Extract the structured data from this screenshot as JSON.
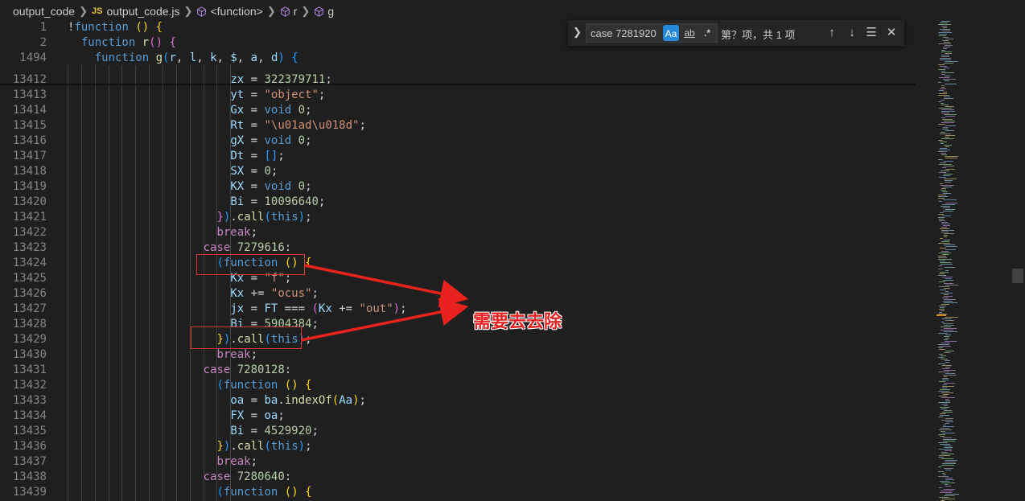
{
  "breadcrumb": {
    "folder": "output_code",
    "file_badge": "JS",
    "file": "output_code.js",
    "func": "<function>",
    "r": "r",
    "g": "g"
  },
  "find_widget": {
    "query": "case 7281920",
    "match_case": "Aa",
    "whole_word": "ab",
    "regex": ".*",
    "result": "第？项，共 1 项"
  },
  "annotation": {
    "label": "需要去去除",
    "color": "#e62222"
  },
  "sticky_lines": [
    {
      "num": "1",
      "indent": 0,
      "tokens": [
        [
          "pl",
          "!"
        ],
        [
          "kw",
          "function"
        ],
        [
          "pl",
          " "
        ],
        [
          "p1",
          "()"
        ],
        [
          "pl",
          " "
        ],
        [
          "p1",
          "{"
        ]
      ]
    },
    {
      "num": "2",
      "indent": 1,
      "tokens": [
        [
          "kw",
          "function"
        ],
        [
          "pl",
          " "
        ],
        [
          "fn",
          "r"
        ],
        [
          "p2",
          "()"
        ],
        [
          "pl",
          " "
        ],
        [
          "p2",
          "{"
        ]
      ]
    },
    {
      "num": "1494",
      "indent": 2,
      "tokens": [
        [
          "kw",
          "function"
        ],
        [
          "pl",
          " "
        ],
        [
          "fn",
          "g"
        ],
        [
          "p3",
          "("
        ],
        [
          "var",
          "r"
        ],
        [
          "pl",
          ", "
        ],
        [
          "var",
          "l"
        ],
        [
          "pl",
          ", "
        ],
        [
          "var",
          "k"
        ],
        [
          "pl",
          ", "
        ],
        [
          "var",
          "$"
        ],
        [
          "pl",
          ", "
        ],
        [
          "var",
          "a"
        ],
        [
          "pl",
          ", "
        ],
        [
          "var",
          "d"
        ],
        [
          "p3",
          ")"
        ],
        [
          "pl",
          " "
        ],
        [
          "p3",
          "{"
        ]
      ]
    }
  ],
  "lines": [
    {
      "num": "13412",
      "indent": 12,
      "tokens": [
        [
          "var",
          "zx"
        ],
        [
          "pl",
          " = "
        ],
        [
          "num",
          "322379711"
        ],
        [
          "pl",
          ";"
        ]
      ]
    },
    {
      "num": "13413",
      "indent": 12,
      "tokens": [
        [
          "var",
          "yt"
        ],
        [
          "pl",
          " = "
        ],
        [
          "str",
          "\"object\""
        ],
        [
          "pl",
          ";"
        ]
      ]
    },
    {
      "num": "13414",
      "indent": 12,
      "tokens": [
        [
          "var",
          "Gx"
        ],
        [
          "pl",
          " = "
        ],
        [
          "kw",
          "void"
        ],
        [
          "pl",
          " "
        ],
        [
          "num",
          "0"
        ],
        [
          "pl",
          ";"
        ]
      ]
    },
    {
      "num": "13415",
      "indent": 12,
      "tokens": [
        [
          "var",
          "Rt"
        ],
        [
          "pl",
          " = "
        ],
        [
          "str",
          "\"\\u01ad\\u018d\""
        ],
        [
          "pl",
          ";"
        ]
      ]
    },
    {
      "num": "13416",
      "indent": 12,
      "tokens": [
        [
          "var",
          "gX"
        ],
        [
          "pl",
          " = "
        ],
        [
          "kw",
          "void"
        ],
        [
          "pl",
          " "
        ],
        [
          "num",
          "0"
        ],
        [
          "pl",
          ";"
        ]
      ]
    },
    {
      "num": "13417",
      "indent": 12,
      "tokens": [
        [
          "var",
          "Dt"
        ],
        [
          "pl",
          " = "
        ],
        [
          "p3",
          "[]"
        ],
        [
          "pl",
          ";"
        ]
      ]
    },
    {
      "num": "13418",
      "indent": 12,
      "tokens": [
        [
          "var",
          "SX"
        ],
        [
          "pl",
          " = "
        ],
        [
          "num",
          "0"
        ],
        [
          "pl",
          ";"
        ]
      ]
    },
    {
      "num": "13419",
      "indent": 12,
      "tokens": [
        [
          "var",
          "KX"
        ],
        [
          "pl",
          " = "
        ],
        [
          "kw",
          "void"
        ],
        [
          "pl",
          " "
        ],
        [
          "num",
          "0"
        ],
        [
          "pl",
          ";"
        ]
      ]
    },
    {
      "num": "13420",
      "indent": 12,
      "tokens": [
        [
          "var",
          "Bi"
        ],
        [
          "pl",
          " = "
        ],
        [
          "num",
          "10096640"
        ],
        [
          "pl",
          ";"
        ]
      ]
    },
    {
      "num": "13421",
      "indent": 11,
      "tokens": [
        [
          "p2",
          "}"
        ],
        [
          "p3",
          ")"
        ],
        [
          "pl",
          "."
        ],
        [
          "fn",
          "call"
        ],
        [
          "p3",
          "("
        ],
        [
          "kw",
          "this"
        ],
        [
          "p3",
          ")"
        ],
        [
          "pl",
          ";"
        ]
      ]
    },
    {
      "num": "13422",
      "indent": 11,
      "tokens": [
        [
          "ctl",
          "break"
        ],
        [
          "pl",
          ";"
        ]
      ]
    },
    {
      "num": "13423",
      "indent": 10,
      "tokens": [
        [
          "ctl",
          "case"
        ],
        [
          "pl",
          " "
        ],
        [
          "num",
          "7279616"
        ],
        [
          "pl",
          ":"
        ]
      ]
    },
    {
      "num": "13424",
      "indent": 11,
      "tokens": [
        [
          "p3",
          "("
        ],
        [
          "kw",
          "function"
        ],
        [
          "pl",
          " "
        ],
        [
          "p1",
          "()"
        ],
        [
          "pl",
          " "
        ],
        [
          "p1",
          "{"
        ]
      ]
    },
    {
      "num": "13425",
      "indent": 12,
      "tokens": [
        [
          "var",
          "Kx"
        ],
        [
          "pl",
          " = "
        ],
        [
          "str",
          "\"f\""
        ],
        [
          "pl",
          ";"
        ]
      ]
    },
    {
      "num": "13426",
      "indent": 12,
      "tokens": [
        [
          "var",
          "Kx"
        ],
        [
          "pl",
          " += "
        ],
        [
          "str",
          "\"ocus\""
        ],
        [
          "pl",
          ";"
        ]
      ]
    },
    {
      "num": "13427",
      "indent": 12,
      "tokens": [
        [
          "var",
          "jx"
        ],
        [
          "pl",
          " = "
        ],
        [
          "var",
          "FT"
        ],
        [
          "pl",
          " === "
        ],
        [
          "p2",
          "("
        ],
        [
          "var",
          "Kx"
        ],
        [
          "pl",
          " += "
        ],
        [
          "str",
          "\"out\""
        ],
        [
          "p2",
          ")"
        ],
        [
          "pl",
          ";"
        ]
      ]
    },
    {
      "num": "13428",
      "indent": 12,
      "tokens": [
        [
          "var",
          "Bi"
        ],
        [
          "pl",
          " = "
        ],
        [
          "num",
          "5904384"
        ],
        [
          "pl",
          ";"
        ]
      ]
    },
    {
      "num": "13429",
      "indent": 11,
      "tokens": [
        [
          "p1",
          "}"
        ],
        [
          "p3",
          ")"
        ],
        [
          "pl",
          "."
        ],
        [
          "fn",
          "call"
        ],
        [
          "p3",
          "("
        ],
        [
          "kw",
          "this"
        ],
        [
          "p3",
          ")"
        ],
        [
          "pl",
          ";"
        ]
      ]
    },
    {
      "num": "13430",
      "indent": 11,
      "tokens": [
        [
          "ctl",
          "break"
        ],
        [
          "pl",
          ";"
        ]
      ]
    },
    {
      "num": "13431",
      "indent": 10,
      "tokens": [
        [
          "ctl",
          "case"
        ],
        [
          "pl",
          " "
        ],
        [
          "num",
          "7280128"
        ],
        [
          "pl",
          ":"
        ]
      ]
    },
    {
      "num": "13432",
      "indent": 11,
      "tokens": [
        [
          "p3",
          "("
        ],
        [
          "kw",
          "function"
        ],
        [
          "pl",
          " "
        ],
        [
          "p1",
          "()"
        ],
        [
          "pl",
          " "
        ],
        [
          "p1",
          "{"
        ]
      ]
    },
    {
      "num": "13433",
      "indent": 12,
      "tokens": [
        [
          "var",
          "oa"
        ],
        [
          "pl",
          " = "
        ],
        [
          "var",
          "ba"
        ],
        [
          "pl",
          "."
        ],
        [
          "fn",
          "indexOf"
        ],
        [
          "p1",
          "("
        ],
        [
          "var",
          "Aa"
        ],
        [
          "p1",
          ")"
        ],
        [
          "pl",
          ";"
        ]
      ]
    },
    {
      "num": "13434",
      "indent": 12,
      "tokens": [
        [
          "var",
          "FX"
        ],
        [
          "pl",
          " = "
        ],
        [
          "var",
          "oa"
        ],
        [
          "pl",
          ";"
        ]
      ]
    },
    {
      "num": "13435",
      "indent": 12,
      "tokens": [
        [
          "var",
          "Bi"
        ],
        [
          "pl",
          " = "
        ],
        [
          "num",
          "4529920"
        ],
        [
          "pl",
          ";"
        ]
      ]
    },
    {
      "num": "13436",
      "indent": 11,
      "tokens": [
        [
          "p1",
          "}"
        ],
        [
          "p3",
          ")"
        ],
        [
          "pl",
          "."
        ],
        [
          "fn",
          "call"
        ],
        [
          "p3",
          "("
        ],
        [
          "kw",
          "this"
        ],
        [
          "p3",
          ")"
        ],
        [
          "pl",
          ";"
        ]
      ]
    },
    {
      "num": "13437",
      "indent": 11,
      "tokens": [
        [
          "ctl",
          "break"
        ],
        [
          "pl",
          ";"
        ]
      ]
    },
    {
      "num": "13438",
      "indent": 10,
      "tokens": [
        [
          "ctl",
          "case"
        ],
        [
          "pl",
          " "
        ],
        [
          "num",
          "7280640"
        ],
        [
          "pl",
          ":"
        ]
      ]
    },
    {
      "num": "13439",
      "indent": 11,
      "tokens": [
        [
          "p3",
          "("
        ],
        [
          "kw",
          "function"
        ],
        [
          "pl",
          " "
        ],
        [
          "p1",
          "()"
        ],
        [
          "pl",
          " "
        ],
        [
          "p1",
          "{"
        ]
      ]
    }
  ]
}
